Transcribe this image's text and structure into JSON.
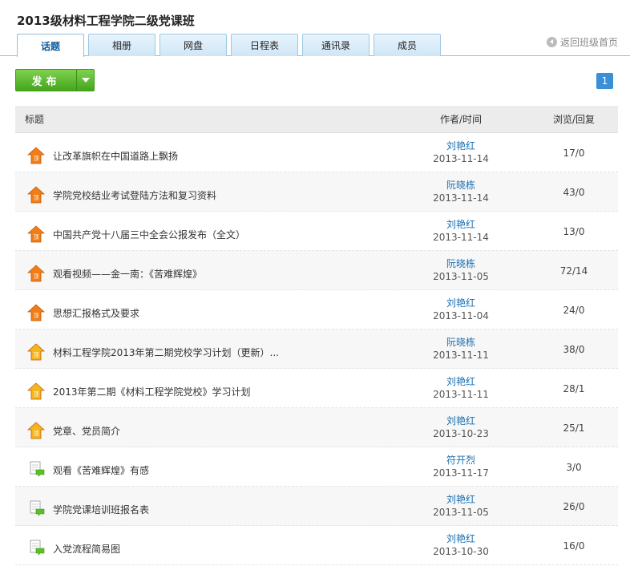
{
  "header": {
    "title": "2013级材料工程学院二级党课班"
  },
  "tabs": [
    {
      "id": "topics",
      "label": "话题",
      "active": true
    },
    {
      "id": "album",
      "label": "相册",
      "active": false
    },
    {
      "id": "disk",
      "label": "网盘",
      "active": false
    },
    {
      "id": "schedule",
      "label": "日程表",
      "active": false
    },
    {
      "id": "contacts",
      "label": "通讯录",
      "active": false
    },
    {
      "id": "members",
      "label": "成员",
      "active": false
    }
  ],
  "back_link": {
    "label": "返回班级首页",
    "icon": "back-arrow-icon"
  },
  "toolbar": {
    "publish_label": "发布",
    "dropdown_icon": "caret-down-icon"
  },
  "pagination": {
    "current": "1"
  },
  "table": {
    "columns": {
      "title": "标题",
      "author_time": "作者/时间",
      "views_replies": "浏览/回复"
    },
    "rows": [
      {
        "icon": "pinned-orange-icon",
        "title": "让改革旗帜在中国道路上飘扬",
        "author": "刘艳红",
        "date": "2013-11-14",
        "stats": "17/0"
      },
      {
        "icon": "pinned-orange-icon",
        "title": "学院党校结业考试登陆方法和复习资料",
        "author": "阮晓栋",
        "date": "2013-11-14",
        "stats": "43/0"
      },
      {
        "icon": "pinned-orange-icon",
        "title": "中国共产党十八届三中全会公报发布（全文）",
        "author": "刘艳红",
        "date": "2013-11-14",
        "stats": "13/0"
      },
      {
        "icon": "pinned-orange-icon",
        "title": "观看视频——金一南：《苦难辉煌》",
        "author": "阮晓栋",
        "date": "2013-11-05",
        "stats": "72/14"
      },
      {
        "icon": "pinned-orange-icon",
        "title": "思想汇报格式及要求",
        "author": "刘艳红",
        "date": "2013-11-04",
        "stats": "24/0"
      },
      {
        "icon": "pinned-yellow-icon",
        "title": "材料工程学院2013年第二期党校学习计划（更新）...",
        "author": "阮晓栋",
        "date": "2013-11-11",
        "stats": "38/0"
      },
      {
        "icon": "pinned-yellow-icon",
        "title": "2013年第二期《材料工程学院党校》学习计划",
        "author": "刘艳红",
        "date": "2013-11-11",
        "stats": "28/1"
      },
      {
        "icon": "pinned-yellow-icon",
        "title": "党章、党员简介",
        "author": "刘艳红",
        "date": "2013-10-23",
        "stats": "25/1"
      },
      {
        "icon": "document-comment-icon",
        "title": "观看《苦难辉煌》有感",
        "author": "符开烈",
        "date": "2013-11-17",
        "stats": "3/0"
      },
      {
        "icon": "document-comment-icon",
        "title": "学院党课培训班报名表",
        "author": "刘艳红",
        "date": "2013-11-05",
        "stats": "26/0"
      },
      {
        "icon": "document-comment-icon",
        "title": "入党流程简易图",
        "author": "刘艳红",
        "date": "2013-10-30",
        "stats": "16/0"
      }
    ]
  },
  "colors": {
    "accent_blue": "#3a8fd6",
    "link_blue": "#1a6fb0",
    "publish_green": "#45a51c",
    "pin_orange": "#f07d18",
    "pin_yellow": "#f5b51c"
  }
}
